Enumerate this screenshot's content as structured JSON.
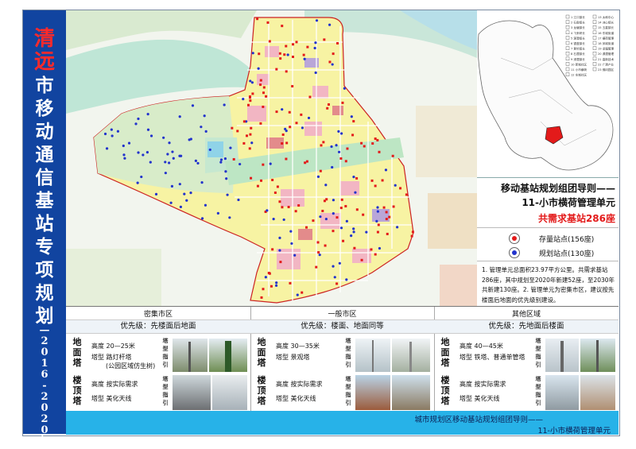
{
  "sidebar": {
    "title_highlight": "清远",
    "title_rest": "市移动通信基站专项规划",
    "years": "——2016-2020年"
  },
  "inset_map": {
    "legend_items": [
      "1 江口镇长",
      "2 石角镇长",
      "3 龙塘镇长",
      "4 飞来峡长",
      "5 源潭镇长",
      "6 银盏镇长",
      "7 黄坑镇长",
      "8 石潭镇长",
      "9 浸潭镇长",
      "10 新城社区",
      "11 小市横荷",
      "12 东城社区",
      "13 太和中心",
      "14 洲心镇长",
      "15 五星镇长",
      "16 东城街道",
      "17 横荷管理",
      "18 凤城街道",
      "19 龙塘管理",
      "20 源潭管理",
      "21 高新技术",
      "22 广清产业",
      "23 佛冈园区"
    ]
  },
  "legend_panel": {
    "title_line1": "移动基站规划组团导则——",
    "title_line2": "11-小市横荷管理单元",
    "total": "共需求基站286座",
    "existing_label": "存量站点",
    "existing_count": "(156座)",
    "planned_label": "规划站点",
    "planned_count": "(130座)",
    "notes": "1. 管理单元总面积23.97平方公里。共需求基站286座，其中规划至2020年新建52座，至2030年共新建130座。2. 管理单元为密集市区，建议按先楼面后地面的优先级别建设。",
    "colors": {
      "existing": "#e31a1a",
      "planned": "#2233cc"
    }
  },
  "zones": [
    {
      "name": "密集市区",
      "priority": "优先级：先楼面后地面",
      "ground_label": "地面塔",
      "roof_label": "楼顶塔",
      "type_label": "塔型指引",
      "ground_height": "高度  20—25米",
      "ground_type_line1": "塔型  路灯杆塔",
      "ground_type_line2": "(公园区域仿生树)",
      "roof_height": "高度  按实际需求",
      "roof_type": "塔型  美化天线"
    },
    {
      "name": "一般市区",
      "priority": "优先级：楼面、地面同等",
      "ground_label": "地面塔",
      "roof_label": "楼顶塔",
      "type_label": "塔型指引",
      "ground_height": "高度  30—35米",
      "ground_type_line1": "塔型  景观塔",
      "ground_type_line2": "",
      "roof_height": "高度  按实际需求",
      "roof_type": "塔型  美化天线"
    },
    {
      "name": "其他区域",
      "priority": "优先级：先地面后楼面",
      "ground_label": "地面塔",
      "roof_label": "楼顶塔",
      "type_label": "塔型指引",
      "ground_height": "高度  40—45米",
      "ground_type_line1": "塔型  铁塔、普通单管塔",
      "ground_type_line2": "",
      "roof_height": "高度  按实际需求",
      "roof_type": "塔型  美化天线"
    }
  ],
  "footer": {
    "line1": "城市规划区移动基站规划组团导则——",
    "line2": "11-小市横荷管理单元"
  }
}
